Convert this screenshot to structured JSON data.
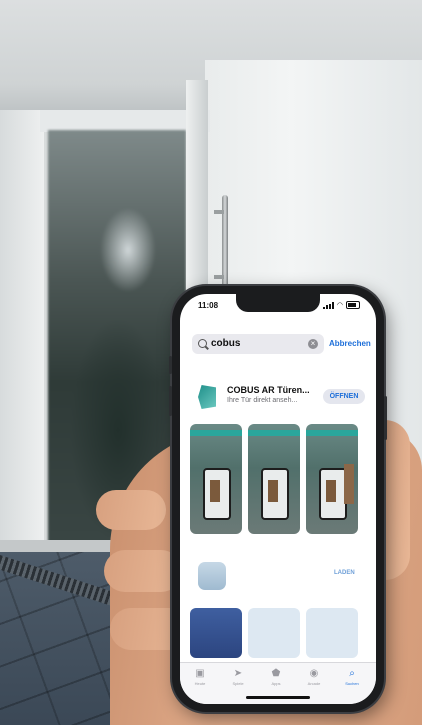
{
  "status_bar": {
    "time": "11:08"
  },
  "search": {
    "query": "cobus",
    "cancel_label": "Abbrechen"
  },
  "result": {
    "app_name": "COBUS AR Türen...",
    "app_subtitle": "Ihre Tür direkt anseh...",
    "open_label": "ÖFFNEN"
  },
  "second_result": {
    "get_label": "LADEN"
  },
  "tabs": [
    {
      "label": "Heute",
      "icon": "today-icon"
    },
    {
      "label": "Spiele",
      "icon": "rocket-icon"
    },
    {
      "label": "Apps",
      "icon": "apps-stack-icon"
    },
    {
      "label": "Arcade",
      "icon": "joystick-icon"
    },
    {
      "label": "Suchen",
      "icon": "search-icon",
      "active": true
    }
  ],
  "colors": {
    "accent": "#1e6fd9",
    "app_teal": "#2aa69c"
  }
}
